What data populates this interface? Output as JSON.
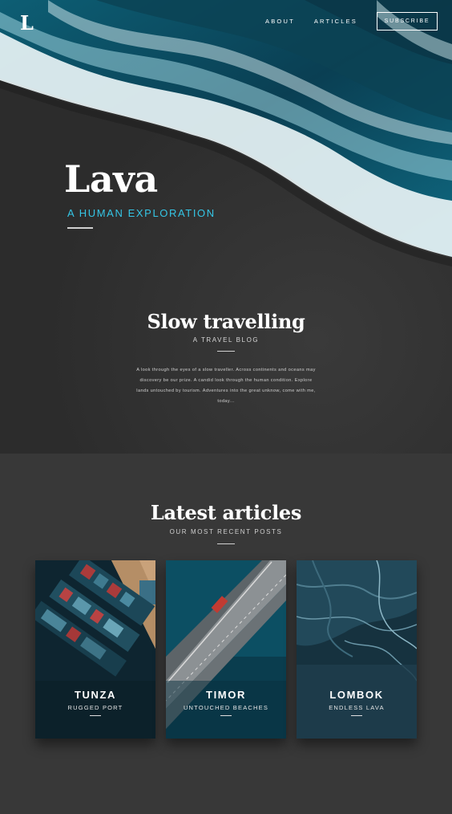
{
  "brand": {
    "logo": "L"
  },
  "nav": {
    "about": "ABOUT",
    "articles": "ARTICLES",
    "subscribe": "SUBSCRIBE"
  },
  "hero": {
    "title": "Lava",
    "subtitle": "A HUMAN EXPLORATION"
  },
  "intro": {
    "title": "Slow travelling",
    "subtitle": "A TRAVEL BLOG",
    "text": "A look through the eyes of a slow traveller. Across continents and oceans may discovery be our prize. A candid look through the human condition. Explore lands untouched by tourism. Adventures into the great unknow, come with me, today..."
  },
  "latest": {
    "title": "Latest articles",
    "subtitle": "OUR MOST RECENT POSTS",
    "cards": [
      {
        "title": "TUNZA",
        "subtitle": "RUGGED PORT"
      },
      {
        "title": "TIMOR",
        "subtitle": "UNTOUCHED BEACHES"
      },
      {
        "title": "LOMBOK",
        "subtitle": "ENDLESS LAVA"
      }
    ]
  },
  "colors": {
    "accent": "#35c6e6",
    "background": "#383838",
    "hero_dark": "#2f2f2f"
  }
}
